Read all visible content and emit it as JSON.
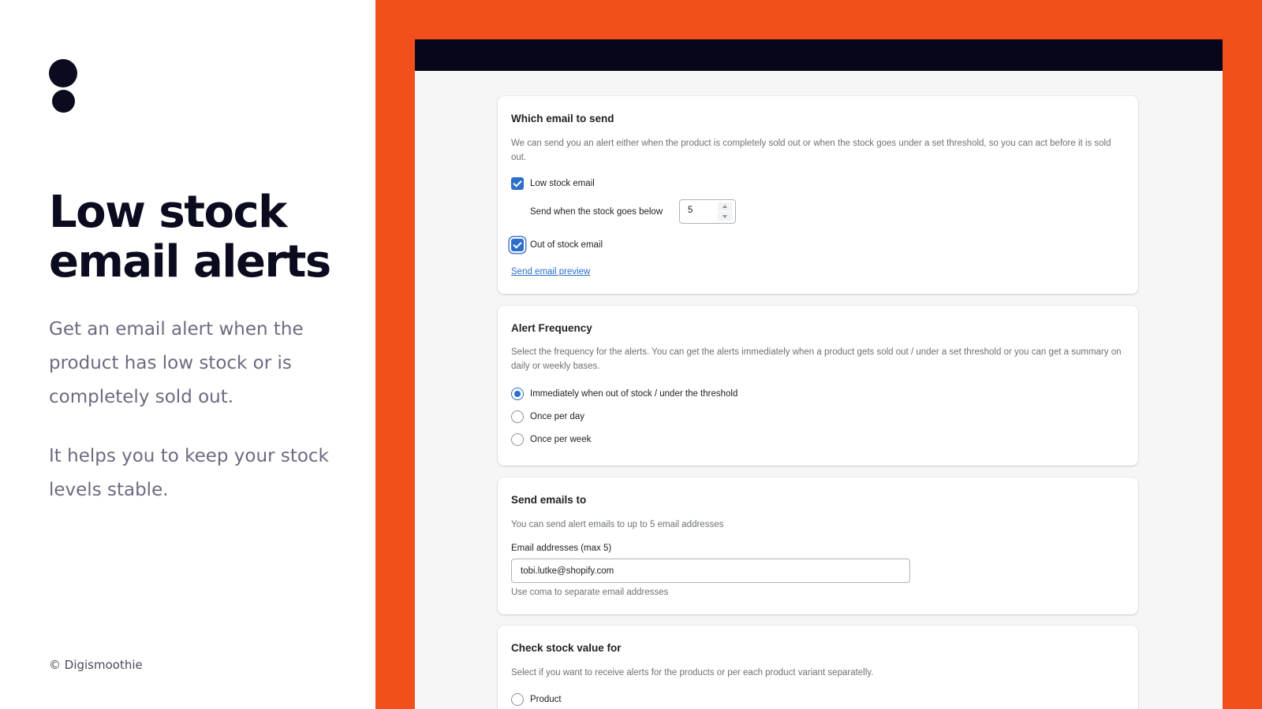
{
  "promo": {
    "headline_line1": "Low stock",
    "headline_line2": "email alerts",
    "para1": "Get an email alert when the product has low stock or is completely sold out.",
    "para2": "It helps you to keep your stock levels stable.",
    "copyright": "© Digismoothie"
  },
  "colors": {
    "accent_orange": "#f24f1d",
    "dark": "#0b0b1f",
    "app_blue": "#2c6ecb"
  },
  "email_card": {
    "title": "Which email to send",
    "description": "We can send you an alert either when the product is completely sold out or when the stock goes under a set threshold, so you can act before it is sold out.",
    "low_stock": {
      "label": "Low stock email",
      "checked": true
    },
    "threshold_label": "Send when the stock goes below",
    "threshold_value": "5",
    "out_of_stock": {
      "label": "Out of stock email",
      "checked": true
    },
    "preview_link": "Send email preview"
  },
  "frequency_card": {
    "title": "Alert Frequency",
    "description": "Select the frequency for the alerts. You can get the alerts immediately when a product gets sold out / under a set threshold or you can get a summary on daily or weekly bases.",
    "options": [
      {
        "label": "Immediately when out of stock / under the threshold",
        "selected": true
      },
      {
        "label": "Once per day",
        "selected": false
      },
      {
        "label": "Once per week",
        "selected": false
      }
    ]
  },
  "recipients_card": {
    "title": "Send emails to",
    "description": "You can send alert emails to up to 5 email addresses",
    "field_label": "Email addresses (max 5)",
    "field_value": "tobi.lutke@shopify.com",
    "help_text": "Use coma to separate email addresses"
  },
  "stock_value_card": {
    "title": "Check stock value for",
    "description": "Select if you want to receive alerts for the products or per each product variant separatelly.",
    "options": [
      {
        "label": "Product",
        "selected": false
      }
    ]
  }
}
